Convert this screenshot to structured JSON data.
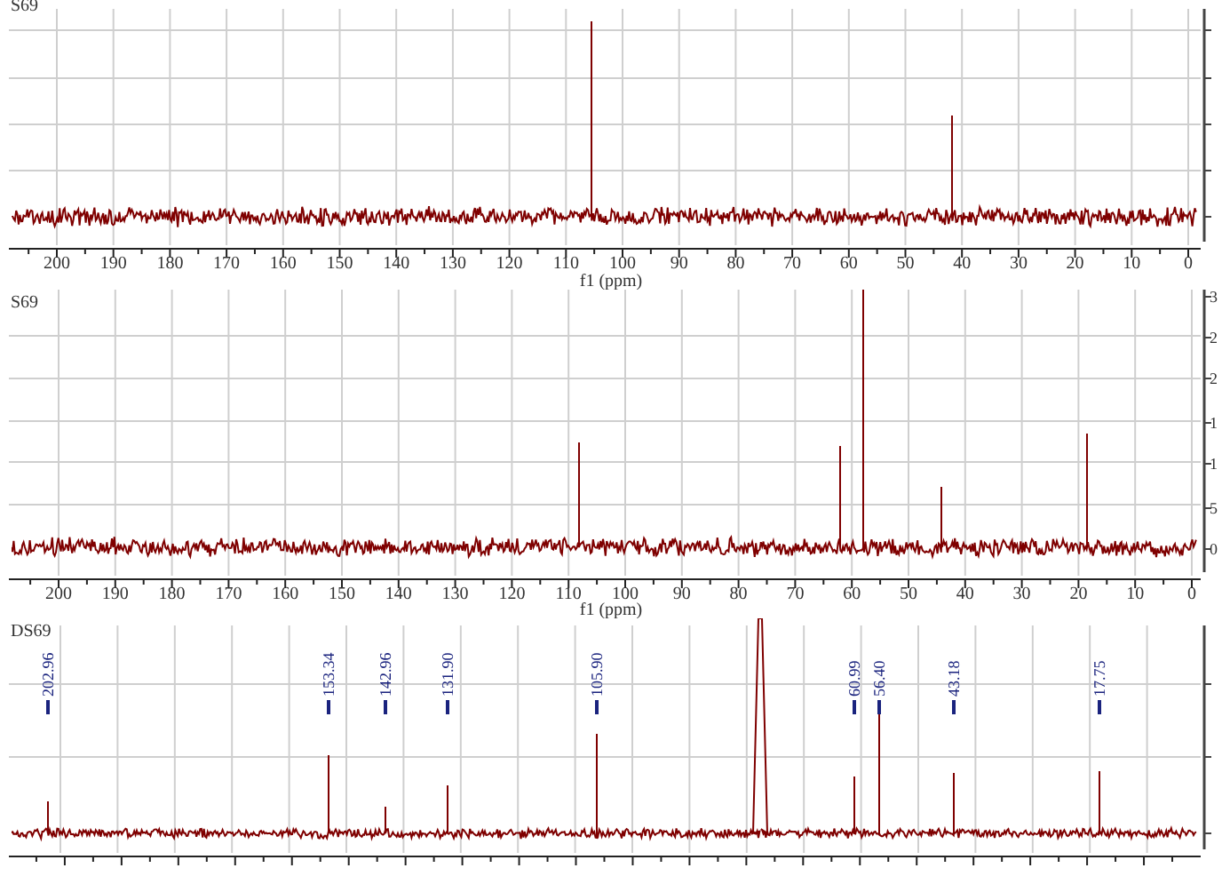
{
  "panels": [
    {
      "title": "S69",
      "x_ticks": [
        "200",
        "190",
        "180",
        "170",
        "160",
        "150",
        "140",
        "130",
        "120",
        "110",
        "100",
        "90",
        "80",
        "70",
        "60",
        "50",
        "40",
        "30",
        "20",
        "10",
        "0"
      ],
      "x_label": "f1 (ppm)"
    },
    {
      "title": "S69",
      "x_ticks": [
        "200",
        "190",
        "180",
        "170",
        "160",
        "150",
        "140",
        "130",
        "120",
        "110",
        "100",
        "90",
        "80",
        "70",
        "60",
        "50",
        "40",
        "30",
        "20",
        "10",
        "0"
      ],
      "x_label": "f1 (ppm)",
      "y_ticks": [
        "3",
        "2",
        "2",
        "1",
        "1",
        "5",
        "0"
      ]
    },
    {
      "title": "DS69",
      "peak_labels": [
        "202.96",
        "153.34",
        "142.96",
        "131.90",
        "105.90",
        "60.99",
        "56.40",
        "43.18",
        "17.75"
      ]
    }
  ]
}
